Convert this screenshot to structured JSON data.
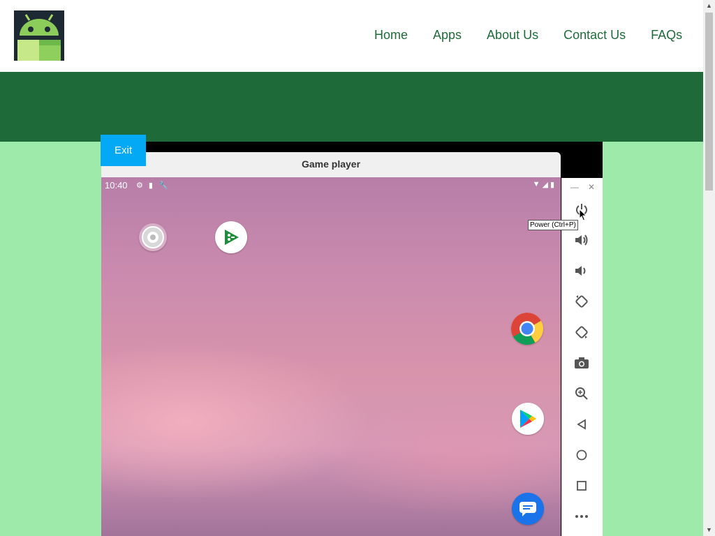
{
  "nav": {
    "items": [
      "Home",
      "Apps",
      "About Us",
      "Contact Us",
      "FAQs"
    ]
  },
  "player": {
    "exit_label": "Exit",
    "title": "Game player",
    "status_time": "10:40",
    "tooltip": "Power (Ctrl+P)"
  },
  "home_icons": [
    "screen-recorder-icon",
    "google-play-games-icon",
    "chrome-icon",
    "google-play-store-icon",
    "messages-icon"
  ],
  "side_controls": [
    "power-icon",
    "volume-up-icon",
    "volume-down-icon",
    "rotate-left-icon",
    "rotate-right-icon",
    "camera-icon",
    "zoom-icon",
    "back-icon",
    "home-icon",
    "overview-icon",
    "more-icon"
  ],
  "colors": {
    "header_band": "#1e6b39",
    "page_background": "#9eeaab",
    "nav_text": "#1f6b3a",
    "exit_button": "#03a9f4"
  }
}
